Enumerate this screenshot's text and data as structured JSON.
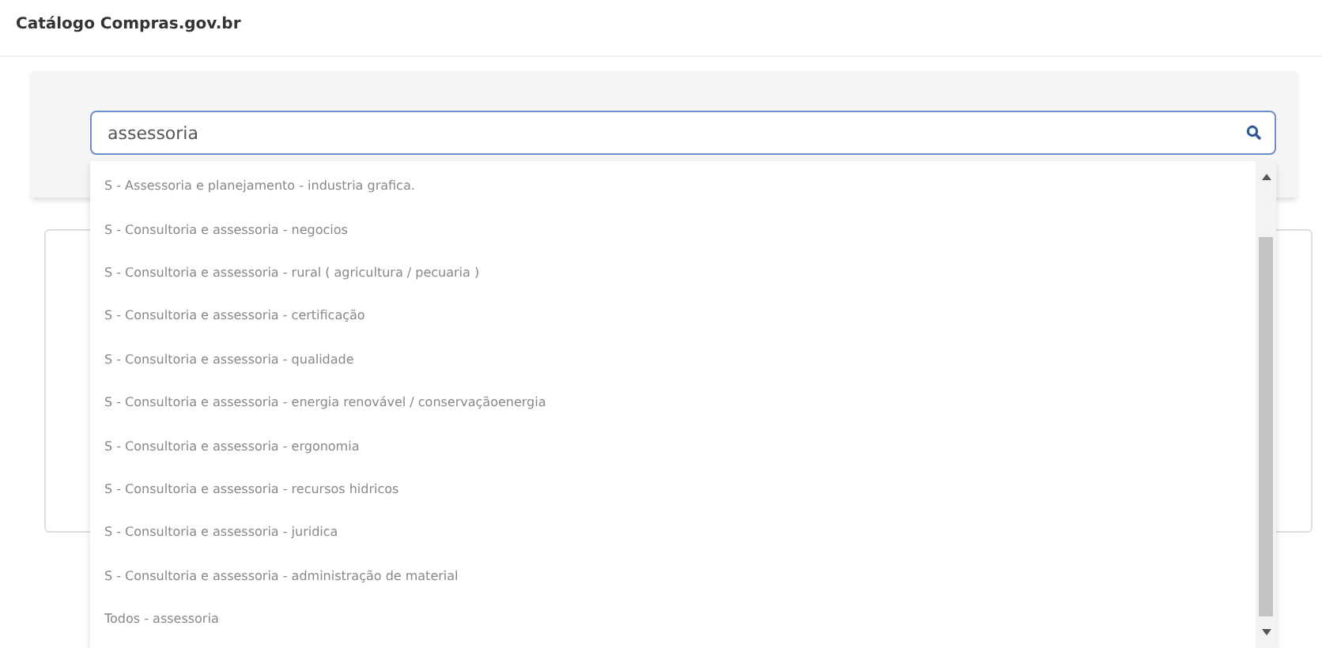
{
  "title": "Catálogo Compras.gov.br",
  "search": {
    "value": "assessoria"
  },
  "suggestions": [
    "S - Assessoria e planejamento - industria grafica.",
    "S - Consultoria e assessoria - negocios",
    "S - Consultoria e assessoria - rural ( agricultura / pecuaria )",
    "S - Consultoria e assessoria - certificação",
    "S - Consultoria e assessoria - qualidade",
    "S - Consultoria e assessoria - energia renovável / conservaçãoenergia",
    "S - Consultoria e assessoria - ergonomia",
    "S - Consultoria e assessoria - recursos hidricos",
    "S - Consultoria e assessoria - juridica",
    "S - Consultoria e assessoria - administração de material",
    "Todos - assessoria"
  ]
}
